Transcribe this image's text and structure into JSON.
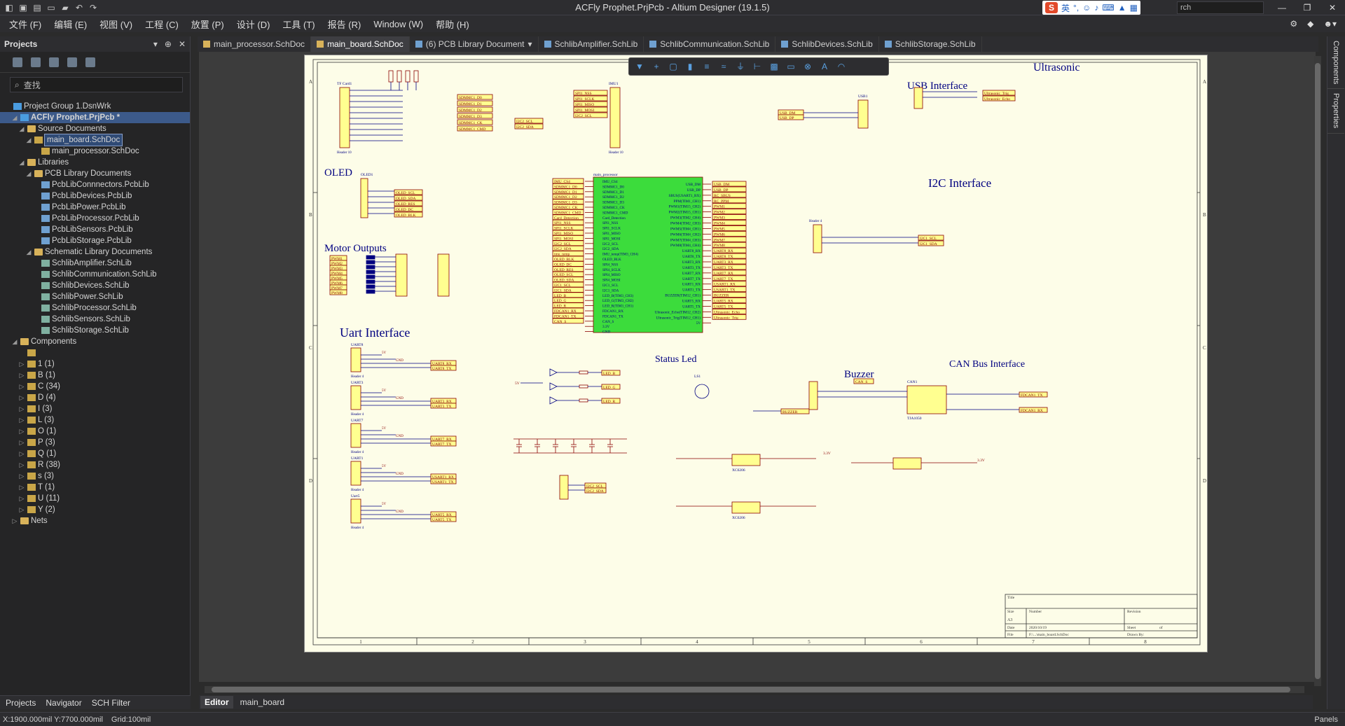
{
  "app": {
    "title": "ACFly Prophet.PrjPcb - Altium Designer (19.1.5)",
    "search_placeholder": "rch"
  },
  "ime": {
    "lang": "英"
  },
  "menu": [
    "文件 (F)",
    "编辑 (E)",
    "视图 (V)",
    "工程 (C)",
    "放置 (P)",
    "设计 (D)",
    "工具 (T)",
    "报告 (R)",
    "Window (W)",
    "帮助 (H)"
  ],
  "projects_panel": {
    "title": "Projects",
    "search_placeholder": "查找",
    "tree": [
      {
        "label": "Project Group 1.DsnWrk",
        "indent": 0,
        "tw": "",
        "icon": "proj"
      },
      {
        "label": "ACFly Prophet.PrjPcb *",
        "indent": 1,
        "tw": "◢",
        "icon": "proj",
        "selected": true
      },
      {
        "label": "Source Documents",
        "indent": 2,
        "tw": "◢",
        "icon": "folder"
      },
      {
        "label": "main_board.SchDoc",
        "indent": 3,
        "tw": "◢",
        "icon": "file",
        "outline": true
      },
      {
        "label": "main_processor.SchDoc",
        "indent": 4,
        "tw": "",
        "icon": "file"
      },
      {
        "label": "Libraries",
        "indent": 2,
        "tw": "◢",
        "icon": "folder"
      },
      {
        "label": "PCB Library Documents",
        "indent": 3,
        "tw": "◢",
        "icon": "folder"
      },
      {
        "label": "PcbLibConnnectors.PcbLib",
        "indent": 4,
        "tw": "",
        "icon": "pcblib"
      },
      {
        "label": "PcbLibDevices.PcbLib",
        "indent": 4,
        "tw": "",
        "icon": "pcblib"
      },
      {
        "label": "PcbLibPower.PcbLib",
        "indent": 4,
        "tw": "",
        "icon": "pcblib"
      },
      {
        "label": "PcbLibProcessor.PcbLib",
        "indent": 4,
        "tw": "",
        "icon": "pcblib"
      },
      {
        "label": "PcbLibSensors.PcbLib",
        "indent": 4,
        "tw": "",
        "icon": "pcblib"
      },
      {
        "label": "PcbLibStorage.PcbLib",
        "indent": 4,
        "tw": "",
        "icon": "pcblib"
      },
      {
        "label": "Schematic Library Documents",
        "indent": 3,
        "tw": "◢",
        "icon": "folder"
      },
      {
        "label": "SchlibAmplifier.SchLib",
        "indent": 4,
        "tw": "",
        "icon": "schlib"
      },
      {
        "label": "SchlibCommunication.SchLib",
        "indent": 4,
        "tw": "",
        "icon": "schlib"
      },
      {
        "label": "SchlibDevices.SchLib",
        "indent": 4,
        "tw": "",
        "icon": "schlib"
      },
      {
        "label": "SchlibPower.SchLib",
        "indent": 4,
        "tw": "",
        "icon": "schlib"
      },
      {
        "label": "SchlibProcessor.SchLib",
        "indent": 4,
        "tw": "",
        "icon": "schlib"
      },
      {
        "label": "SchlibSensors.SchLib",
        "indent": 4,
        "tw": "",
        "icon": "schlib"
      },
      {
        "label": "SchlibStorage.SchLib",
        "indent": 4,
        "tw": "",
        "icon": "schlib"
      },
      {
        "label": "Components",
        "indent": 1,
        "tw": "◢",
        "icon": "folder"
      },
      {
        "label": "",
        "indent": 2,
        "tw": "",
        "icon": "file"
      },
      {
        "label": "1 (1)",
        "indent": 2,
        "tw": "▷",
        "icon": "file"
      },
      {
        "label": "B (1)",
        "indent": 2,
        "tw": "▷",
        "icon": "file"
      },
      {
        "label": "C (34)",
        "indent": 2,
        "tw": "▷",
        "icon": "file"
      },
      {
        "label": "D (4)",
        "indent": 2,
        "tw": "▷",
        "icon": "file"
      },
      {
        "label": "I (3)",
        "indent": 2,
        "tw": "▷",
        "icon": "file"
      },
      {
        "label": "L (3)",
        "indent": 2,
        "tw": "▷",
        "icon": "file"
      },
      {
        "label": "O (1)",
        "indent": 2,
        "tw": "▷",
        "icon": "file"
      },
      {
        "label": "P (3)",
        "indent": 2,
        "tw": "▷",
        "icon": "file"
      },
      {
        "label": "Q (1)",
        "indent": 2,
        "tw": "▷",
        "icon": "file"
      },
      {
        "label": "R (38)",
        "indent": 2,
        "tw": "▷",
        "icon": "file"
      },
      {
        "label": "s (3)",
        "indent": 2,
        "tw": "▷",
        "icon": "file"
      },
      {
        "label": "T (1)",
        "indent": 2,
        "tw": "▷",
        "icon": "file"
      },
      {
        "label": "U (11)",
        "indent": 2,
        "tw": "▷",
        "icon": "file"
      },
      {
        "label": "Y (2)",
        "indent": 2,
        "tw": "▷",
        "icon": "file"
      },
      {
        "label": "Nets",
        "indent": 1,
        "tw": "▷",
        "icon": "folder"
      }
    ],
    "bottom_tabs": [
      "Projects",
      "Navigator",
      "SCH Filter"
    ]
  },
  "doc_tabs": [
    {
      "label": "main_processor.SchDoc",
      "kind": "sch",
      "active": false
    },
    {
      "label": "main_board.SchDoc",
      "kind": "sch",
      "active": true
    },
    {
      "label": "(6) PCB Library Document",
      "kind": "lib",
      "active": false
    },
    {
      "label": "SchlibAmplifier.SchLib",
      "kind": "lib",
      "active": false
    },
    {
      "label": "SchlibCommunication.SchLib",
      "kind": "lib",
      "active": false
    },
    {
      "label": "SchlibDevices.SchLib",
      "kind": "lib",
      "active": false
    },
    {
      "label": "SchlibStorage.SchLib",
      "kind": "lib",
      "active": false
    }
  ],
  "right_strip": [
    "Components",
    "Properties"
  ],
  "schematic": {
    "section_titles": {
      "ultrasonic": "Ultrasonic",
      "usb": "USB Interface",
      "oled": "OLED",
      "i2c": "I2C Interface",
      "motor": "Motor Outputs",
      "uart": "Uart Interface",
      "status_led": "Status Led",
      "buzzer": "Buzzer",
      "can": "CAN Bus Interface"
    },
    "main_processor_label": "main_processor",
    "left_pins": [
      "IMU_CS4",
      "SDMMC1_D0",
      "SDMMC1_D1",
      "SDMMC1_D2",
      "SDMMC1_D3",
      "SDMMC1_CK",
      "SDMMC1_CMD",
      "Card_Detection",
      "SPI1_NSS",
      "SPI1_SCLK",
      "SPI1_MISO",
      "SPI1_MOSI",
      "I2C2_SCL",
      "I2C2_SDA",
      "IMU_temp(TIM3_CH4)",
      "OLED_BLK",
      "SPI4_NSS",
      "SPI4_SCLK",
      "SPI4_MISO",
      "SPI4_MOSI",
      "I2C1_SCL",
      "I2C1_SDA",
      "LED_B(TIM3_CH3)",
      "LED_G(TIM3_CH2)",
      "LED_R(TIM3_CH1)",
      "FDCAN1_RX",
      "FDCAN1_TX",
      "CAN_S",
      "3.3V",
      "GND"
    ],
    "right_pins": [
      "USB_DM",
      "USB_DP",
      "SBUS(USART1_RX)",
      "PPM(TIM1_CH1)",
      "PWM1(TIM15_CH2)",
      "PWM2(TIM15_CH1)",
      "PWM3(TIM2_CH4)",
      "PWM4(TIM2_CH3)",
      "PWM5(TIM4_CH1)",
      "PWM6(TIM4_CH2)",
      "PWM7(TIM4_CH3)",
      "PWM8(TIM4_CH4)",
      "UART8_RX",
      "UART8_TX",
      "UART3_RX",
      "UART3_TX",
      "UART7_RX",
      "UART7_TX",
      "UART1_RX",
      "UART1_TX",
      "BUZZER(TIM12_CH1)",
      "UART5_RX",
      "UART5_TX",
      "Ultrasonic_Echo(TIM12_CH2)",
      "Ultrasonic_Trig(TIM12_CH1)",
      "5V"
    ],
    "right_nets": [
      "USB_DM",
      "USB_DP",
      "RC_SBUS",
      "RC_PPM",
      "PWM1",
      "PWM2",
      "PWM3",
      "PWM4",
      "PWM5",
      "PWM6",
      "PWM7",
      "PWM8",
      "UART8_RX",
      "UART8_TX",
      "UART3_RX",
      "UART3_TX",
      "UART7_RX",
      "UART7_TX",
      "USART1_RX",
      "USART1_TX",
      "BUZZER",
      "UART5_RX",
      "UART5_TX",
      "Ultrasonic_Echo",
      "Ultrasonic_Trig"
    ],
    "left_nets": [
      "IMU_CS4",
      "SDMMC1_D0",
      "SDMMC1_D1",
      "SDMMC1_D2",
      "SDMMC1_D3",
      "SDMMC1_CK",
      "SDMMC1_CMD",
      "Card_Detection",
      "SPI1_NSS",
      "SPI1_SCLK",
      "SPI1_MISO",
      "SPI1_MOSI",
      "I2C2_SCL",
      "I2C2_SDA",
      "imu_temp",
      "OLED_BLK",
      "OLED_DC",
      "OLED_RES",
      "OLED_SCL",
      "OLED_SDA",
      "I2C1_SCL",
      "I2C1_SDA",
      "LED_B",
      "LED_G",
      "LED_R",
      "FDCAN1_RX",
      "FDCAN1_TX",
      "CAN_S"
    ],
    "row_labels": [
      "A",
      "B",
      "C",
      "D"
    ],
    "col_labels": [
      "1",
      "2",
      "3",
      "4",
      "5",
      "6",
      "7",
      "8"
    ],
    "title_block": {
      "title": "Title",
      "size_label": "Size",
      "size": "A3",
      "number_label": "Number",
      "revision_label": "Revision",
      "date_label": "Date",
      "date": "2020/10/19",
      "sheet_label": "Sheet",
      "of_label": "of",
      "file_label": "File",
      "file": "F:\\...\\main_board.SchDoc",
      "drawn_label": "Drawn By:"
    },
    "uart_headers": [
      {
        "ref": "UART8",
        "rx": "UART8_RX",
        "tx": "UART8_TX"
      },
      {
        "ref": "UART3",
        "rx": "UART3_RX",
        "tx": "UART3_TX"
      },
      {
        "ref": "UART7",
        "rx": "UART7_RX",
        "tx": "UART7_TX"
      },
      {
        "ref": "UART1",
        "rx": "USART1_RX",
        "tx": "USART1_TX"
      },
      {
        "ref": "Uart5",
        "rx": "UART5_RX",
        "tx": "UART5_TX"
      }
    ],
    "misc": {
      "tf_card": "TF Card1",
      "imu": "IMU1",
      "header10": "Header 10",
      "header4": "Header 4",
      "oled_ref": "OLED1",
      "usb_ref": "USB1",
      "can_ref": "CAN1",
      "can_chip": "TJA1050",
      "u1": "XC6206",
      "buzzer_ref": "LS1",
      "gnd": "GND",
      "v33": "3.3V",
      "v5": "5V"
    }
  },
  "editor_tabs": [
    "Editor",
    "main_board"
  ],
  "status": {
    "coords": "X:1900.000mil Y:7700.000mil",
    "grid": "Grid:100mil",
    "panels": "Panels"
  }
}
